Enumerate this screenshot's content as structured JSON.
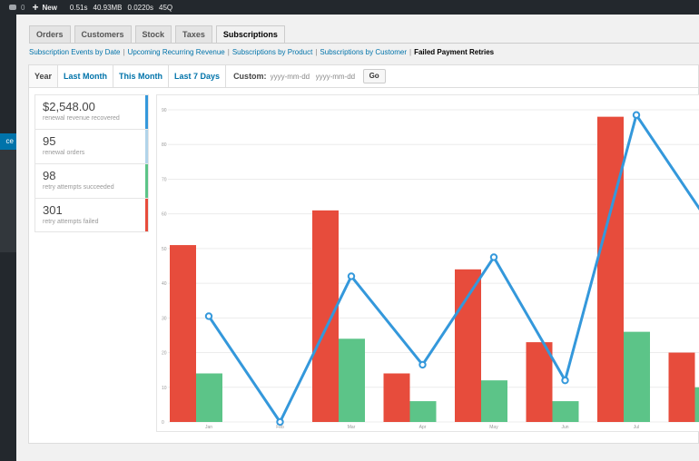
{
  "adminbar": {
    "comments_count": "0",
    "new_label": "New",
    "perf": [
      "0.51s",
      "40.93MB",
      "0.0220s",
      "45Q"
    ]
  },
  "adminmenu": {
    "current_label": "ce"
  },
  "nav_tabs": [
    "Orders",
    "Customers",
    "Stock",
    "Taxes",
    "Subscriptions"
  ],
  "active_tab": "Subscriptions",
  "sub_reports": {
    "links": [
      "Subscription Events by Date",
      "Upcoming Recurring Revenue",
      "Subscriptions by Product",
      "Subscriptions by Customer"
    ],
    "current": "Failed Payment Retries",
    "separator": "|"
  },
  "range_tabs": [
    "Year",
    "Last Month",
    "This Month",
    "Last 7 Days"
  ],
  "active_range": "Year",
  "custom": {
    "label": "Custom:",
    "from_placeholder": "yyyy-mm-dd",
    "to_placeholder": "yyyy-mm-dd",
    "go_label": "Go"
  },
  "legend": [
    {
      "amount": "$2,548.00",
      "label": "renewal revenue recovered",
      "color": "#3498db"
    },
    {
      "amount": "95",
      "label": "renewal orders",
      "color": "#b1d4ea"
    },
    {
      "amount": "98",
      "label": "retry attempts succeeded",
      "color": "#5cc488"
    },
    {
      "amount": "301",
      "label": "retry attempts failed",
      "color": "#e74c3c"
    }
  ],
  "colors": {
    "failed": "#e74c3c",
    "succeeded": "#5cc488",
    "revenue_line": "#3498db",
    "link": "#0073aa"
  },
  "chart_data": {
    "type": "bar",
    "categories": [
      "Jan",
      "Feb",
      "Mar",
      "Apr",
      "May",
      "Jun",
      "Jul"
    ],
    "ylim": [
      0,
      90
    ],
    "yticks": [
      0,
      10,
      20,
      30,
      40,
      50,
      60,
      70,
      80,
      90
    ],
    "grid": true,
    "series": [
      {
        "name": "retry attempts failed",
        "type": "bar",
        "values": [
          51,
          0,
          61,
          14,
          44,
          23,
          88,
          20
        ]
      },
      {
        "name": "retry attempts succeeded",
        "type": "bar",
        "values": [
          14,
          0,
          24,
          6,
          12,
          6,
          26,
          10
        ]
      },
      {
        "name": "renewal revenue recovered",
        "type": "line",
        "values": [
          30.5,
          0,
          42,
          16.5,
          47.5,
          12,
          88.5,
          58
        ]
      }
    ]
  }
}
